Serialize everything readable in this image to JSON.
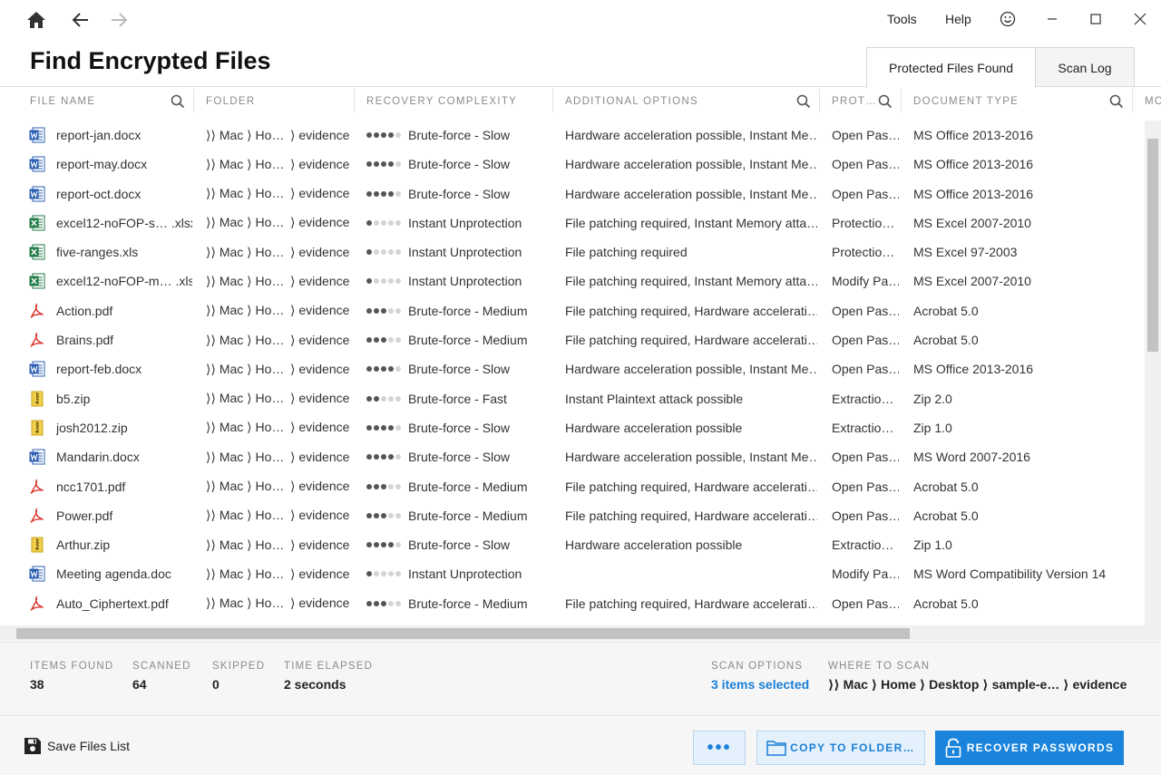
{
  "menu": {
    "tools": "Tools",
    "help": "Help"
  },
  "page_title": "Find Encrypted Files",
  "tabs": [
    {
      "label": "Protected Files Found",
      "active": true
    },
    {
      "label": "Scan Log",
      "active": false
    }
  ],
  "columns": {
    "file_name": "FILE NAME",
    "folder": "FOLDER",
    "recovery_complexity": "RECOVERY COMPLEXITY",
    "additional_options": "ADDITIONAL OPTIONS",
    "protection": "PROT…",
    "document_type": "DOCUMENT TYPE",
    "more": "MO"
  },
  "rows": [
    {
      "icon": "word-icon",
      "name": "report-jan.docx",
      "folder_a": "⟩⟩ Mac ⟩ Ho…",
      "folder_b": "⟩ evidence",
      "level": 4,
      "complexity": "Brute-force - Slow",
      "options": "Hardware acceleration possible, Instant Me…",
      "protection": "Open Pas…",
      "doctype": "MS Office 2013-2016"
    },
    {
      "icon": "word-icon",
      "name": "report-may.docx",
      "folder_a": "⟩⟩ Mac ⟩ Ho…",
      "folder_b": "⟩ evidence",
      "level": 4,
      "complexity": "Brute-force - Slow",
      "options": "Hardware acceleration possible, Instant Me…",
      "protection": "Open Pas…",
      "doctype": "MS Office 2013-2016"
    },
    {
      "icon": "word-icon",
      "name": "report-oct.docx",
      "folder_a": "⟩⟩ Mac ⟩ Ho…",
      "folder_b": "⟩ evidence",
      "level": 4,
      "complexity": "Brute-force - Slow",
      "options": "Hardware acceleration possible, Instant Me…",
      "protection": "Open Pas…",
      "doctype": "MS Office 2013-2016"
    },
    {
      "icon": "excel-icon",
      "name": "excel12-noFOP-s… .xlsx",
      "folder_a": "⟩⟩ Mac ⟩ Ho…",
      "folder_b": "⟩ evidence",
      "level": 1,
      "complexity": "Instant Unprotection",
      "options": "File patching required, Instant Memory atta…",
      "protection": "Protectio…",
      "doctype": "MS Excel 2007-2010"
    },
    {
      "icon": "excel-icon",
      "name": "five-ranges.xls",
      "folder_a": "⟩⟩ Mac ⟩ Ho…",
      "folder_b": "⟩ evidence",
      "level": 1,
      "complexity": "Instant Unprotection",
      "options": "File patching required",
      "protection": "Protectio…",
      "doctype": "MS Excel 97-2003"
    },
    {
      "icon": "excel-icon",
      "name": "excel12-noFOP-m… .xlsx",
      "folder_a": "⟩⟩ Mac ⟩ Ho…",
      "folder_b": "⟩ evidence",
      "level": 1,
      "complexity": "Instant Unprotection",
      "options": "File patching required, Instant Memory atta…",
      "protection": "Modify Pa…",
      "doctype": "MS Excel 2007-2010"
    },
    {
      "icon": "pdf-icon",
      "name": "Action.pdf",
      "folder_a": "⟩⟩ Mac ⟩ Ho…",
      "folder_b": "⟩ evidence",
      "level": 3,
      "complexity": "Brute-force - Medium",
      "options": "File patching required, Hardware accelerati…",
      "protection": "Open Pas…",
      "doctype": "Acrobat 5.0"
    },
    {
      "icon": "pdf-icon",
      "name": "Brains.pdf",
      "folder_a": "⟩⟩ Mac ⟩ Ho…",
      "folder_b": "⟩ evidence",
      "level": 3,
      "complexity": "Brute-force - Medium",
      "options": "File patching required, Hardware accelerati…",
      "protection": "Open Pas…",
      "doctype": "Acrobat 5.0"
    },
    {
      "icon": "word-icon",
      "name": "report-feb.docx",
      "folder_a": "⟩⟩ Mac ⟩ Ho…",
      "folder_b": "⟩ evidence",
      "level": 4,
      "complexity": "Brute-force - Slow",
      "options": "Hardware acceleration possible, Instant Me…",
      "protection": "Open Pas…",
      "doctype": "MS Office 2013-2016"
    },
    {
      "icon": "zip-icon",
      "name": "b5.zip",
      "folder_a": "⟩⟩ Mac ⟩ Ho…",
      "folder_b": "⟩ evidence",
      "level": 2,
      "complexity": "Brute-force - Fast",
      "options": "Instant Plaintext attack possible",
      "protection": "Extractio…",
      "doctype": "Zip 2.0"
    },
    {
      "icon": "zip-icon",
      "name": "josh2012.zip",
      "folder_a": "⟩⟩ Mac ⟩ Ho…",
      "folder_b": "⟩ evidence",
      "level": 4,
      "complexity": "Brute-force - Slow",
      "options": "Hardware acceleration possible",
      "protection": "Extractio…",
      "doctype": "Zip 1.0"
    },
    {
      "icon": "word-icon",
      "name": "Mandarin.docx",
      "folder_a": "⟩⟩ Mac ⟩ Ho…",
      "folder_b": "⟩ evidence",
      "level": 4,
      "complexity": "Brute-force - Slow",
      "options": "Hardware acceleration possible, Instant Me…",
      "protection": "Open Pas…",
      "doctype": "MS Word 2007-2016"
    },
    {
      "icon": "pdf-icon",
      "name": "ncc1701.pdf",
      "folder_a": "⟩⟩ Mac ⟩ Ho…",
      "folder_b": "⟩ evidence",
      "level": 3,
      "complexity": "Brute-force - Medium",
      "options": "File patching required, Hardware accelerati…",
      "protection": "Open Pas…",
      "doctype": "Acrobat 5.0"
    },
    {
      "icon": "pdf-icon",
      "name": "Power.pdf",
      "folder_a": "⟩⟩ Mac ⟩ Ho…",
      "folder_b": "⟩ evidence",
      "level": 3,
      "complexity": "Brute-force - Medium",
      "options": "File patching required, Hardware accelerati…",
      "protection": "Open Pas…",
      "doctype": "Acrobat 5.0"
    },
    {
      "icon": "zip-icon",
      "name": "Arthur.zip",
      "folder_a": "⟩⟩ Mac ⟩ Ho…",
      "folder_b": "⟩ evidence",
      "level": 4,
      "complexity": "Brute-force - Slow",
      "options": "Hardware acceleration possible",
      "protection": "Extractio…",
      "doctype": "Zip 1.0"
    },
    {
      "icon": "word-icon",
      "name": "Meeting agenda.doc",
      "folder_a": "⟩⟩ Mac ⟩ Ho…",
      "folder_b": "⟩ evidence",
      "level": 1,
      "complexity": "Instant Unprotection",
      "options": "",
      "protection": "Modify Pa…",
      "doctype": "MS Word Compatibility Version 14"
    },
    {
      "icon": "pdf-icon",
      "name": "Auto_Ciphertext.pdf",
      "folder_a": "⟩⟩ Mac ⟩ Ho…",
      "folder_b": "⟩ evidence",
      "level": 3,
      "complexity": "Brute-force - Medium",
      "options": "File patching required, Hardware accelerati…",
      "protection": "Open Pas…",
      "doctype": "Acrobat 5.0"
    }
  ],
  "stats": {
    "items_found_label": "ITEMS FOUND",
    "items_found": "38",
    "scanned_label": "SCANNED",
    "scanned": "64",
    "skipped_label": "SKIPPED",
    "skipped": "0",
    "time_elapsed_label": "TIME ELAPSED",
    "time_elapsed": "2 seconds",
    "scan_options_label": "SCAN OPTIONS",
    "scan_options": "3 items selected",
    "where_label": "WHERE TO SCAN",
    "where": "⟩⟩ Mac ⟩ Home ⟩ Desktop ⟩ sample-e… ⟩ evidence"
  },
  "footer": {
    "save_label": "Save Files List",
    "more_label": "•••",
    "copy_label": "COPY TO FOLDER…",
    "recover_label": "RECOVER PASSWORDS"
  },
  "colors": {
    "accent": "#1a84dd",
    "word": "#2b5fb3",
    "excel": "#1f7a45",
    "pdf": "#d9362b",
    "zip": "#e8c23a"
  }
}
